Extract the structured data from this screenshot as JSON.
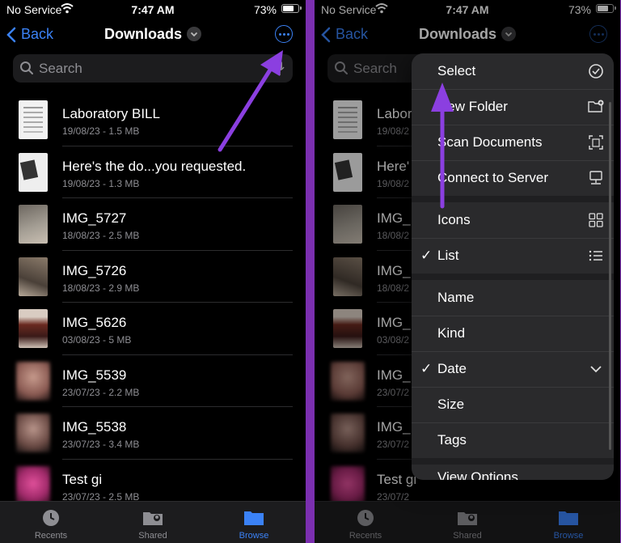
{
  "status": {
    "carrier": "No Service",
    "time": "7:47 AM",
    "battery": "73%"
  },
  "nav": {
    "back_label": "Back",
    "title": "Downloads"
  },
  "search": {
    "placeholder": "Search"
  },
  "files": [
    {
      "name": "Laboratory BILL",
      "meta": "19/08/23 - 1.5 MB"
    },
    {
      "name": "Here's the do...you requested.",
      "meta": "19/08/23 - 1.3 MB"
    },
    {
      "name": "IMG_5727",
      "meta": "18/08/23 - 2.5 MB"
    },
    {
      "name": "IMG_5726",
      "meta": "18/08/23 - 2.9 MB"
    },
    {
      "name": "IMG_5626",
      "meta": "03/08/23 - 5 MB"
    },
    {
      "name": "IMG_5539",
      "meta": "23/07/23 - 2.2 MB"
    },
    {
      "name": "IMG_5538",
      "meta": "23/07/23 - 3.4 MB"
    },
    {
      "name": "Test gi",
      "meta": "23/07/23 - 2.5 MB"
    }
  ],
  "right_files": [
    {
      "name": "Labor",
      "meta": "19/08/2"
    },
    {
      "name": "Here'",
      "meta": "19/08/2"
    },
    {
      "name": "IMG_",
      "meta": "18/08/2"
    },
    {
      "name": "IMG_",
      "meta": "18/08/2"
    },
    {
      "name": "IMG_",
      "meta": "03/08/2"
    },
    {
      "name": "IMG_",
      "meta": "23/07/2"
    },
    {
      "name": "IMG_",
      "meta": "23/07/2"
    },
    {
      "name": "Test gi",
      "meta": "23/07/2"
    }
  ],
  "tabs": {
    "recents": "Recents",
    "shared": "Shared",
    "browse": "Browse"
  },
  "menu": {
    "select": "Select",
    "new_folder": "New Folder",
    "scan": "Scan Documents",
    "connect": "Connect to Server",
    "icons": "Icons",
    "list": "List",
    "name": "Name",
    "kind": "Kind",
    "date": "Date",
    "size": "Size",
    "tags": "Tags",
    "view_options": "View Options",
    "check": "✓"
  },
  "colors": {
    "accent": "#3b82f6",
    "annotation": "#8b3fe0"
  }
}
